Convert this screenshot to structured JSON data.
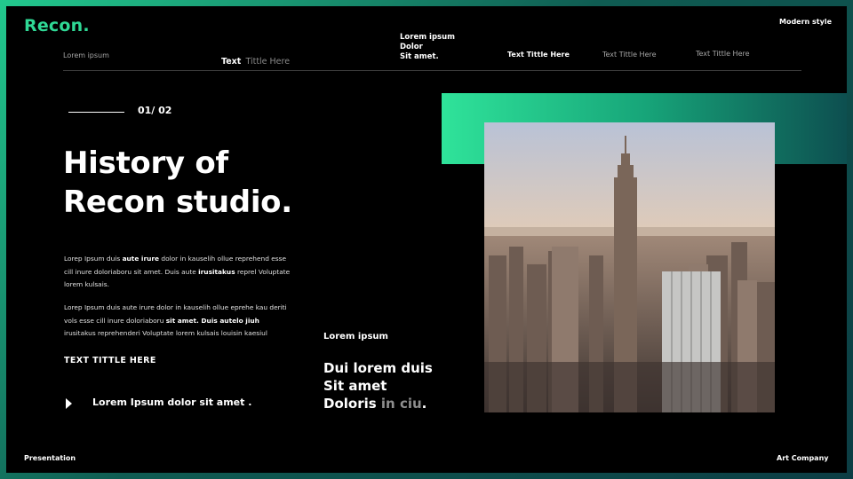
{
  "brand": {
    "name": "Recon",
    "dot": ".",
    "accent": "#2fd895"
  },
  "header": {
    "corner_label": "Modern style"
  },
  "nav": {
    "item1": "Lorem ipsum",
    "item2_strong": "Text",
    "item2_dim": "Tittle Here",
    "item3_lines": [
      "Lorem ipsum",
      "Dolor",
      "Sit amet."
    ],
    "item4": "Text Tittle Here",
    "item5": "Text Tittle Here",
    "item6": "Text Tittle Here"
  },
  "counter": "01/ 02",
  "title_lines": [
    "History of",
    "Recon studio."
  ],
  "paragraph1": {
    "s1": "Lorep  Ipsum duis ",
    "b1": "aute irure",
    "s2": " dolor in kauselih ollue reprehend esse cill inure doloriaboru sit amet. Duis aute ",
    "b2": "irusitakus",
    "s3": " reprel Voluptate lorem kulsais."
  },
  "paragraph2": {
    "s1": "Lorep  Ipsum duis aute irure dolor in kauselih ollue eprehe kau deriti vols esse cill inure doloriaboru ",
    "b1": "sit amet. Duis autelo jiuh",
    "s2": " irusitakus reprehenderi Voluptate lorem kulsais louisin kaesiul"
  },
  "section_title": "TEXT TITTLE HERE",
  "play_item": "Lorem Ipsum dolor sit amet .",
  "mid": {
    "small": "Lorem ipsum",
    "line1": "Dui lorem duis",
    "line2": "Sit amet",
    "line3_strong": "Doloris",
    "line3_dim": "in ciu",
    "line3_end": "."
  },
  "footer": {
    "left": "Presentation",
    "right": "Art Company"
  },
  "colors": {
    "gradient_light": "#2fe39a",
    "gradient_dark": "#0d4f50",
    "background": "#000000"
  }
}
